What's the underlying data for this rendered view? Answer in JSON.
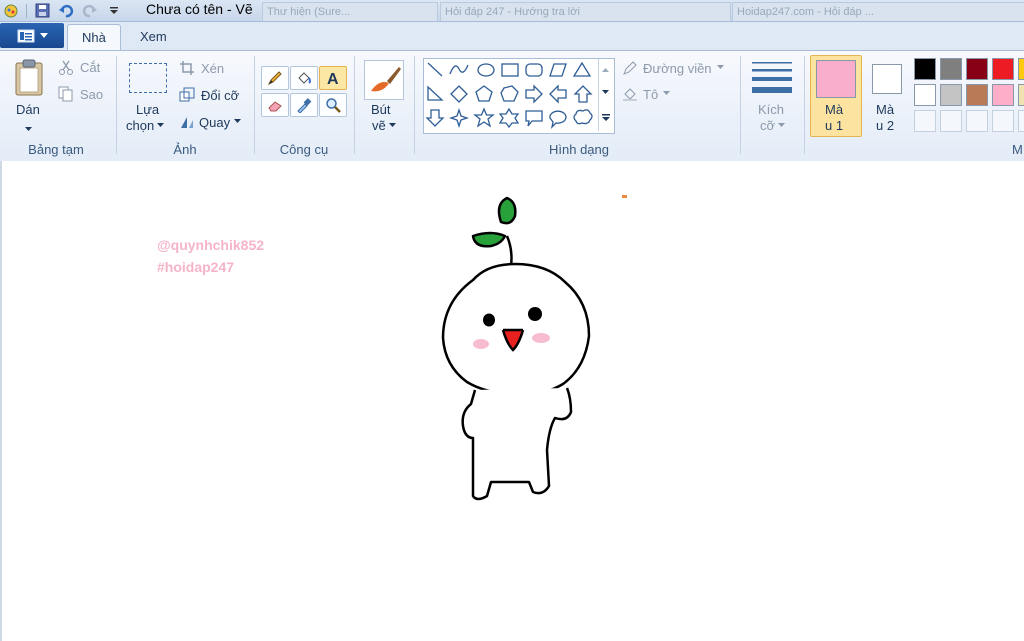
{
  "titlebar": {
    "title": "Chưa có tên - Vẽ",
    "background_tabs": [
      "Thư hiện (Sure...",
      "Hỏi đáp 247 - Hướng tra lời",
      "Hoidap247.com - Hỏi đáp ..."
    ]
  },
  "tabs": {
    "file_icon": "paint-menu-icon",
    "home": "Nhà",
    "view": "Xem"
  },
  "clipboard": {
    "paste": "Dán",
    "cut": "Cắt",
    "copy": "Sao",
    "group": "Bảng tạm"
  },
  "image": {
    "select_line1": "Lựa",
    "select_line2": "chọn",
    "crop": "Xén",
    "resize": "Đổi cỡ",
    "rotate": "Quay",
    "group": "Ảnh"
  },
  "tools": {
    "group": "Công cụ"
  },
  "brushes": {
    "line1": "Bút",
    "line2": "vẽ"
  },
  "shapes": {
    "outline": "Đường viền",
    "fill": "Tô",
    "group": "Hình dạng"
  },
  "size": {
    "line1": "Kích",
    "line2": "cỡ"
  },
  "colors": {
    "color1_line1": "Mà",
    "color1_line2": "u 1",
    "color2_line1": "Mà",
    "color2_line2": "u 2",
    "color1_value": "#f9aecb",
    "color2_value": "#ffffff",
    "palette_row1": [
      "#000000",
      "#7f7f7f",
      "#880015",
      "#ed1c24",
      "#ffc90e"
    ],
    "palette_row2": [
      "#ffffff",
      "#c3c3c3",
      "#b97a57",
      "#ffaec9",
      "#efe4b0"
    ],
    "group_partial": "M"
  },
  "canvas": {
    "watermark_line1": "@quynhchik852",
    "watermark_line2": "#hoidap247"
  }
}
